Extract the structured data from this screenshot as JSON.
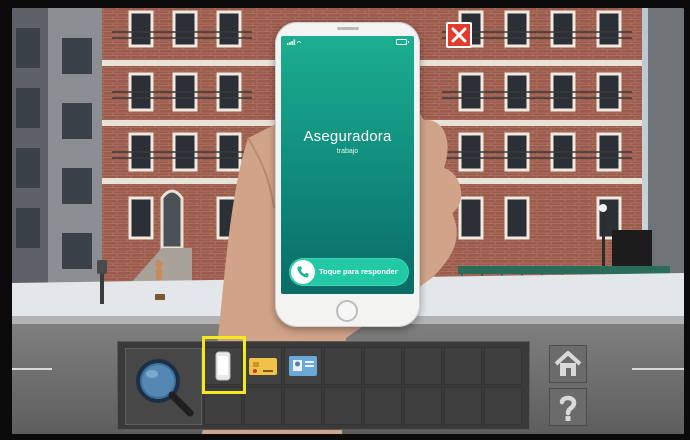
{
  "phone": {
    "caller_name": "Aseguradora",
    "caller_label": "trabajo",
    "answer_label": "Toque para responder",
    "screen_color": "#128f80",
    "accent_color": "#21c9a6"
  },
  "inventory": {
    "highlight_color": "#f4ea1a",
    "items": [
      {
        "slot": 1,
        "icon": "phone-icon"
      },
      {
        "slot": 2,
        "icon": "credit-card-icon"
      },
      {
        "slot": 3,
        "icon": "id-card-icon"
      }
    ],
    "total_slots": 16
  },
  "controls": {
    "close_icon": "close-icon",
    "home_icon": "home-icon",
    "help_icon": "help-icon",
    "search_icon": "magnifier-icon"
  }
}
